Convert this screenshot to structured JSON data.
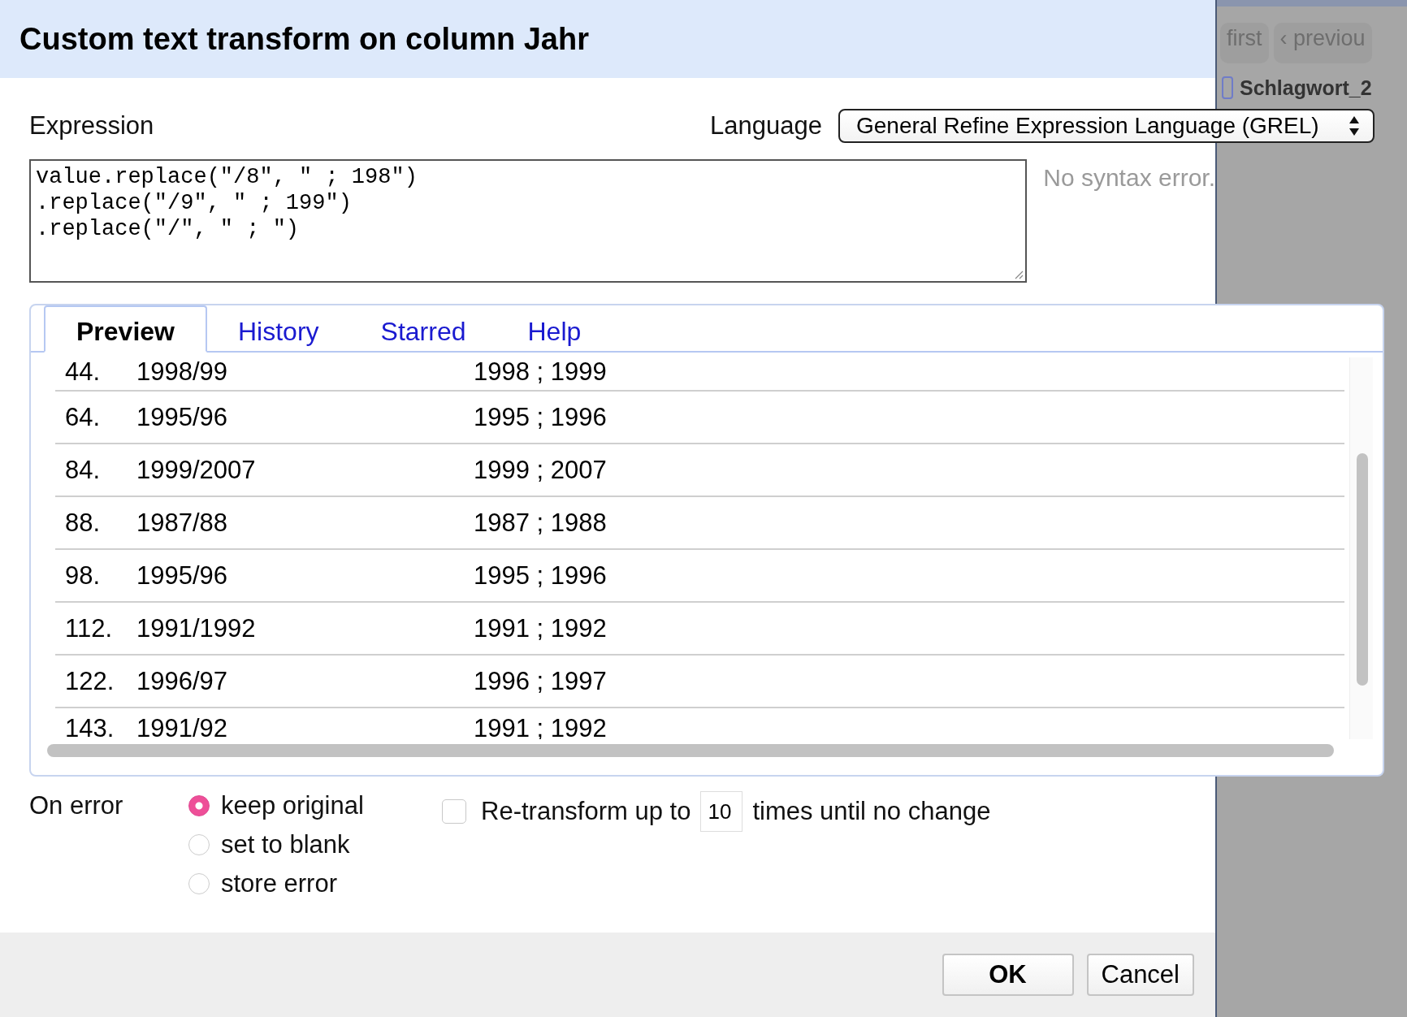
{
  "dialog": {
    "title": "Custom text transform on column Jahr",
    "expression_label": "Expression",
    "language_label": "Language",
    "language": "General Refine Expression Language (GREL)",
    "expression_lines": [
      "value.replace(\"/8\", \" ; 198\")",
      ".replace(\"/9\", \" ; 199\")",
      ".replace(\"/\", \" ; \")"
    ],
    "status": "No syntax error.",
    "tabs": [
      {
        "label": "Preview",
        "selected": true
      },
      {
        "label": "History",
        "selected": false
      },
      {
        "label": "Starred",
        "selected": false
      },
      {
        "label": "Help",
        "selected": false
      }
    ],
    "preview_rows": [
      {
        "row": "44.",
        "value": "1998/99",
        "result": "1998 ; 1999"
      },
      {
        "row": "64.",
        "value": "1995/96",
        "result": "1995 ; 1996"
      },
      {
        "row": "84.",
        "value": "1999/2007",
        "result": "1999 ; 2007"
      },
      {
        "row": "88.",
        "value": "1987/88",
        "result": "1987 ; 1988"
      },
      {
        "row": "98.",
        "value": "1995/96",
        "result": "1995 ; 1996"
      },
      {
        "row": "112.",
        "value": "1991/1992",
        "result": "1991 ; 1992"
      },
      {
        "row": "122.",
        "value": "1996/97",
        "result": "1996 ; 1997"
      },
      {
        "row": "143.",
        "value": "1991/92",
        "result": "1991 ; 1992"
      }
    ],
    "on_error_label": "On error",
    "on_error_options": [
      {
        "label": "keep original",
        "selected": true
      },
      {
        "label": "set to blank",
        "selected": false
      },
      {
        "label": "store error",
        "selected": false
      }
    ],
    "retransform": {
      "checked": false,
      "label_before": "Re-transform up to",
      "times": "10",
      "label_after": "times until no change"
    },
    "buttons": [
      "OK",
      "Cancel"
    ]
  },
  "background": {
    "pager": [
      "first",
      "‹ previou"
    ],
    "column_header": "Schlagwort_2"
  }
}
